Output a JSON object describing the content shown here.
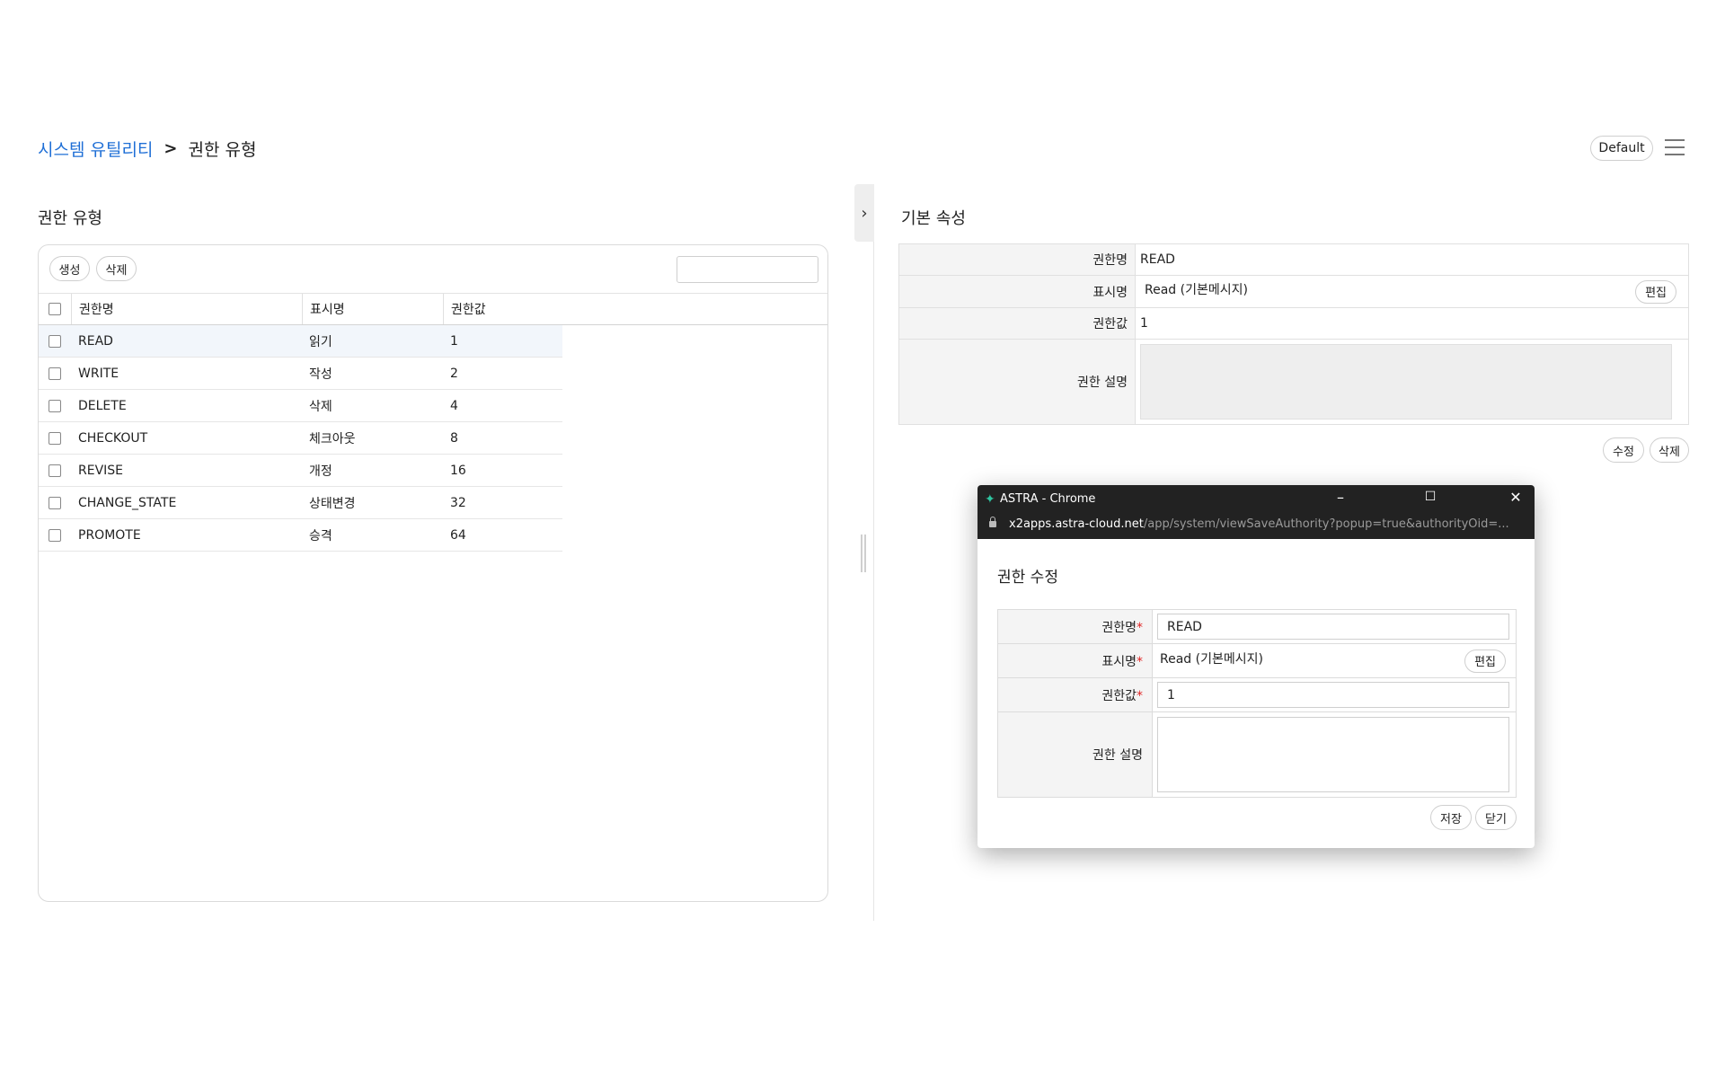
{
  "breadcrumb": {
    "root": "시스템 유틸리티",
    "separator": ">",
    "current": "권한 유형"
  },
  "header": {
    "profile_button": "Default",
    "menu_icon": "hamburger-menu-icon"
  },
  "left_panel": {
    "title": "권한 유형",
    "buttons": {
      "create": "생성",
      "delete": "삭제"
    },
    "search": {
      "value": "",
      "placeholder": ""
    },
    "grid": {
      "columns": [
        "권한명",
        "표시명",
        "권한값"
      ],
      "rows": [
        {
          "name": "READ",
          "display": "읽기",
          "value": "1"
        },
        {
          "name": "WRITE",
          "display": "작성",
          "value": "2"
        },
        {
          "name": "DELETE",
          "display": "삭제",
          "value": "4"
        },
        {
          "name": "CHECKOUT",
          "display": "체크아웃",
          "value": "8"
        },
        {
          "name": "REVISE",
          "display": "개정",
          "value": "16"
        },
        {
          "name": "CHANGE_STATE",
          "display": "상태변경",
          "value": "32"
        },
        {
          "name": "PROMOTE",
          "display": "승격",
          "value": "64"
        }
      ],
      "selected_row": 0
    }
  },
  "splitter": {
    "collapse_icon": "chevron-right-icon",
    "collapse_glyph": "›"
  },
  "right_panel": {
    "title": "기본 속성",
    "fields": {
      "name_label": "권한명",
      "name_value": "READ",
      "display_label": "표시명",
      "display_value": "Read (기본메시지)",
      "edit_button": "편집",
      "value_label": "권한값",
      "value_value": "1",
      "desc_label": "권한 설명",
      "desc_value": ""
    },
    "buttons": {
      "modify": "수정",
      "delete": "삭제"
    }
  },
  "popup": {
    "window_title": "ASTRA - Chrome",
    "url_host": "x2apps.astra-cloud.net",
    "url_path": "/app/system/viewSaveAuthority?popup=true&authorityOid=...",
    "heading": "권한 수정",
    "required_mark": "*",
    "fields": {
      "name_label": "권한명",
      "name_value": "READ",
      "display_label": "표시명",
      "display_value": "Read (기본메시지)",
      "edit_button": "편집",
      "value_label": "권한값",
      "value_value": "1",
      "desc_label": "권한 설명",
      "desc_value": ""
    },
    "buttons": {
      "save": "저장",
      "close": "닫기"
    },
    "window_controls": {
      "minimize": "–",
      "maximize": "☐",
      "close": "✕"
    }
  }
}
